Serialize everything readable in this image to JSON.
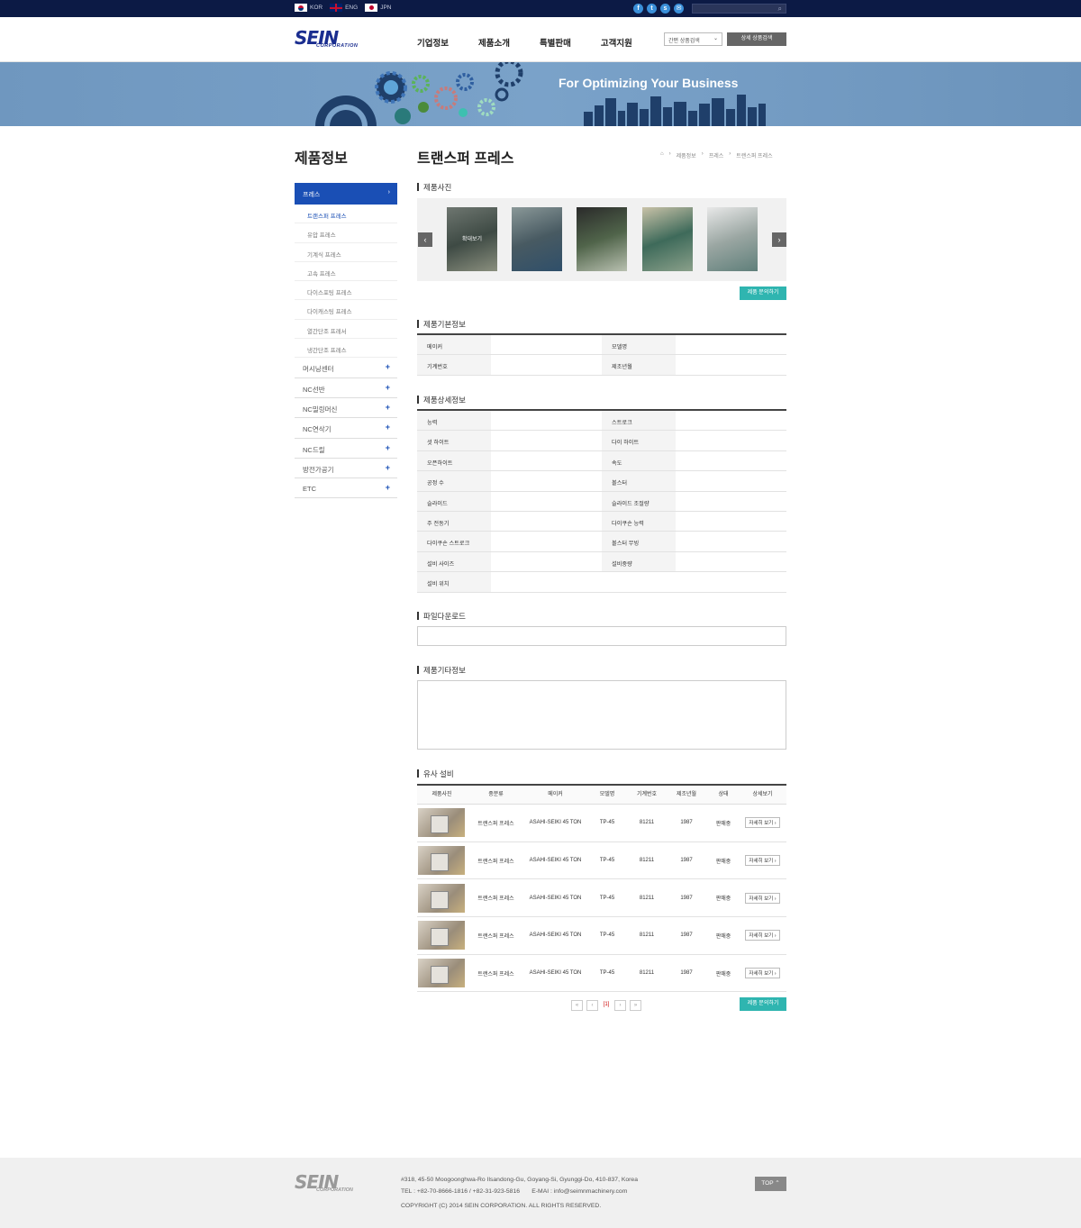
{
  "topbar": {
    "languages": [
      {
        "code": "kor",
        "label": "KOR"
      },
      {
        "code": "eng",
        "label": "ENG"
      },
      {
        "code": "jpn",
        "label": "JPN"
      }
    ],
    "social": [
      "facebook-icon",
      "twitter-icon",
      "skype-icon",
      "mail-icon"
    ]
  },
  "header": {
    "logo_main": "SEIN",
    "logo_sub": "CORPORATION",
    "nav": [
      "기업정보",
      "제품소개",
      "특별판매",
      "고객지원"
    ],
    "quick_search": "간편 상품검색",
    "detail_search": "상세 상품검색"
  },
  "banner": {
    "slogan": "For Optimizing Your Business"
  },
  "lnb": {
    "title": "제품정보",
    "active": "프레스",
    "subs": [
      "트랜스퍼 프레스",
      "유압 프레스",
      "기계식 프레스",
      "고속 프레스",
      "다이스포팅 프레스",
      "다이캐스팅 프레스",
      "열간단조 프레서",
      "냉간단조 프레스"
    ],
    "mains": [
      "머시닝센터",
      "NC선반",
      "NC밀링머신",
      "NC연삭기",
      "NC드릴",
      "방전가공기",
      "ETC"
    ]
  },
  "content": {
    "title": "트랜스퍼 프레스",
    "breadcrumb": [
      "제품정보",
      "프레스",
      "트랜스퍼 프레스"
    ],
    "sections": {
      "photos": "제품사진",
      "basic": "제품기본정보",
      "detail": "제품상세정보",
      "files": "파일다운로드",
      "etc": "제품기타정보",
      "similar": "유사 설비"
    },
    "zoom_label": "확대보기",
    "inquiry_label": "제품 문의하기",
    "basic_info": [
      [
        "메이커",
        "모델명"
      ],
      [
        "기계번호",
        "제조년월"
      ]
    ],
    "detail_info": [
      [
        "능력",
        "스트로크"
      ],
      [
        "셧 하이트",
        "다이 하이트"
      ],
      [
        "오픈하이트",
        "속도"
      ],
      [
        "공정 수",
        "볼스터"
      ],
      [
        "슬라이드",
        "슬라이드 조절량"
      ],
      [
        "주 전동기",
        "다이쿠숀 능력"
      ],
      [
        "다이쿠숀 스트로크",
        "볼스터 무빙"
      ],
      [
        "설비 사이즈",
        "설비중량"
      ],
      [
        "설비 위치"
      ]
    ],
    "similar_headers": [
      "제품사진",
      "중분류",
      "메이커",
      "모델명",
      "기계번호",
      "제조년월",
      "상태",
      "상세보기"
    ],
    "similar_rows": [
      {
        "category": "트랜스퍼 프레스",
        "maker": "ASAHI-SEIKI 45 TON",
        "model": "TP-45",
        "number": "81211",
        "year": "1987",
        "status": "판매중",
        "more": "자세히 보기 ›"
      },
      {
        "category": "트랜스퍼 프레스",
        "maker": "ASAHI-SEIKI 45 TON",
        "model": "TP-45",
        "number": "81211",
        "year": "1987",
        "status": "판매중",
        "more": "자세히 보기 ›"
      },
      {
        "category": "트랜스퍼 프레스",
        "maker": "ASAHI-SEIKI 45 TON",
        "model": "TP-45",
        "number": "81211",
        "year": "1987",
        "status": "판매중",
        "more": "자세히 보기 ›"
      },
      {
        "category": "트랜스퍼 프레스",
        "maker": "ASAHI-SEIKI 45 TON",
        "model": "TP-45",
        "number": "81211",
        "year": "1987",
        "status": "판매중",
        "more": "자세히 보기 ›"
      },
      {
        "category": "트랜스퍼 프레스",
        "maker": "ASAHI-SEIKI 45 TON",
        "model": "TP-45",
        "number": "81211",
        "year": "1987",
        "status": "판매중",
        "more": "자세히 보기 ›"
      }
    ],
    "pager": {
      "first": "«",
      "prev": "‹",
      "current": "[1]",
      "next": "›",
      "last": "»"
    }
  },
  "footer": {
    "address": "#318, 45-50 Moogoonghwa-Ro Ilsandong-Gu, Goyang-Si, Gyunggi-Do, 410-837, Korea",
    "tel": "TEL : +82-70-8666-1816 / +82-31-923-5816",
    "email": "E-MAI : info@seimnmachinery.com",
    "copyright": "COPYRIGHT (C) 2014 SEIN CORPORATION.  ALL RIGHTS RESERVED.",
    "top": "TOP"
  }
}
